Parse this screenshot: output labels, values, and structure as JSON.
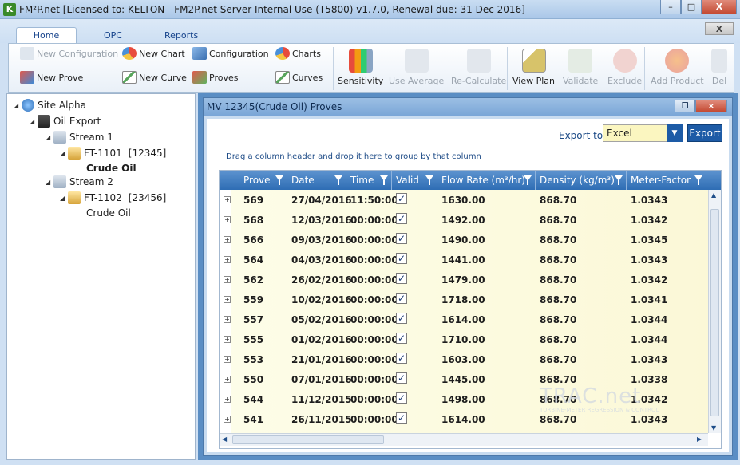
{
  "window": {
    "icon_letter": "K",
    "title": "FM²P.net [Licensed to: KELTON - FM2P.net Server Internal Use (T5800) v1.7.0, Renewal due: 31 Dec 2016]",
    "min": "–",
    "max": "□",
    "close": "X"
  },
  "ribbon": {
    "tabs": [
      "Home",
      "OPC",
      "Reports"
    ],
    "close_btn": "X",
    "small": {
      "new_configuration": "New Configuration",
      "new_prove": "New Prove",
      "new_chart": "New Chart",
      "new_curve": "New Curve",
      "configuration": "Configuration",
      "proves": "Proves",
      "charts": "Charts",
      "curves": "Curves"
    },
    "big": {
      "sensitivity": "Sensitivity",
      "use_average": "Use Average",
      "recalculate": "Re-Calculate",
      "view_plan": "View Plan",
      "validate": "Validate",
      "exclude": "Exclude",
      "add_product": "Add Product",
      "delete": "Del"
    }
  },
  "tree": {
    "site": "Site Alpha",
    "oil_export": "Oil Export",
    "stream1": "Stream 1",
    "ft1101": "FT-1101",
    "ft1101_id": "[12345]",
    "crude1": "Crude Oil",
    "stream2": "Stream 2",
    "ft1102": "FT-1102",
    "ft1102_id": "[23456]",
    "crude2": "Crude Oil"
  },
  "child": {
    "title": "MV 12345(Crude Oil) Proves",
    "export_label": "Export to",
    "export_value": "Excel",
    "export_btn": "Export",
    "group_hint": "Drag a column header and drop it here to group by that column"
  },
  "grid": {
    "headers": [
      "Prove",
      "Date",
      "Time",
      "Valid",
      "Flow Rate (m³/hr)",
      "Density (kg/m³)",
      "Meter-Factor"
    ],
    "rows": [
      {
        "prove": "569",
        "date": "27/04/2016",
        "time": "11:50:00",
        "flow": "1630.00",
        "density": "868.70",
        "mf": "1.0343"
      },
      {
        "prove": "568",
        "date": "12/03/2016",
        "time": "00:00:00",
        "flow": "1492.00",
        "density": "868.70",
        "mf": "1.0342"
      },
      {
        "prove": "566",
        "date": "09/03/2016",
        "time": "00:00:00",
        "flow": "1490.00",
        "density": "868.70",
        "mf": "1.0345"
      },
      {
        "prove": "564",
        "date": "04/03/2016",
        "time": "00:00:00",
        "flow": "1441.00",
        "density": "868.70",
        "mf": "1.0343"
      },
      {
        "prove": "562",
        "date": "26/02/2016",
        "time": "00:00:00",
        "flow": "1479.00",
        "density": "868.70",
        "mf": "1.0342"
      },
      {
        "prove": "559",
        "date": "10/02/2016",
        "time": "00:00:00",
        "flow": "1718.00",
        "density": "868.70",
        "mf": "1.0341"
      },
      {
        "prove": "557",
        "date": "05/02/2016",
        "time": "00:00:00",
        "flow": "1614.00",
        "density": "868.70",
        "mf": "1.0344"
      },
      {
        "prove": "555",
        "date": "01/02/2016",
        "time": "00:00:00",
        "flow": "1710.00",
        "density": "868.70",
        "mf": "1.0344"
      },
      {
        "prove": "553",
        "date": "21/01/2016",
        "time": "00:00:00",
        "flow": "1603.00",
        "density": "868.70",
        "mf": "1.0343"
      },
      {
        "prove": "550",
        "date": "07/01/2016",
        "time": "00:00:00",
        "flow": "1445.00",
        "density": "868.70",
        "mf": "1.0338"
      },
      {
        "prove": "544",
        "date": "11/12/2015",
        "time": "00:00:00",
        "flow": "1498.00",
        "density": "868.70",
        "mf": "1.0342"
      },
      {
        "prove": "541",
        "date": "26/11/2015",
        "time": "00:00:00",
        "flow": "1614.00",
        "density": "868.70",
        "mf": "1.0343"
      }
    ]
  },
  "watermark": {
    "text": "TRAC.net",
    "sub": "TURBINE-METER REGRESSION & CONTROL"
  }
}
